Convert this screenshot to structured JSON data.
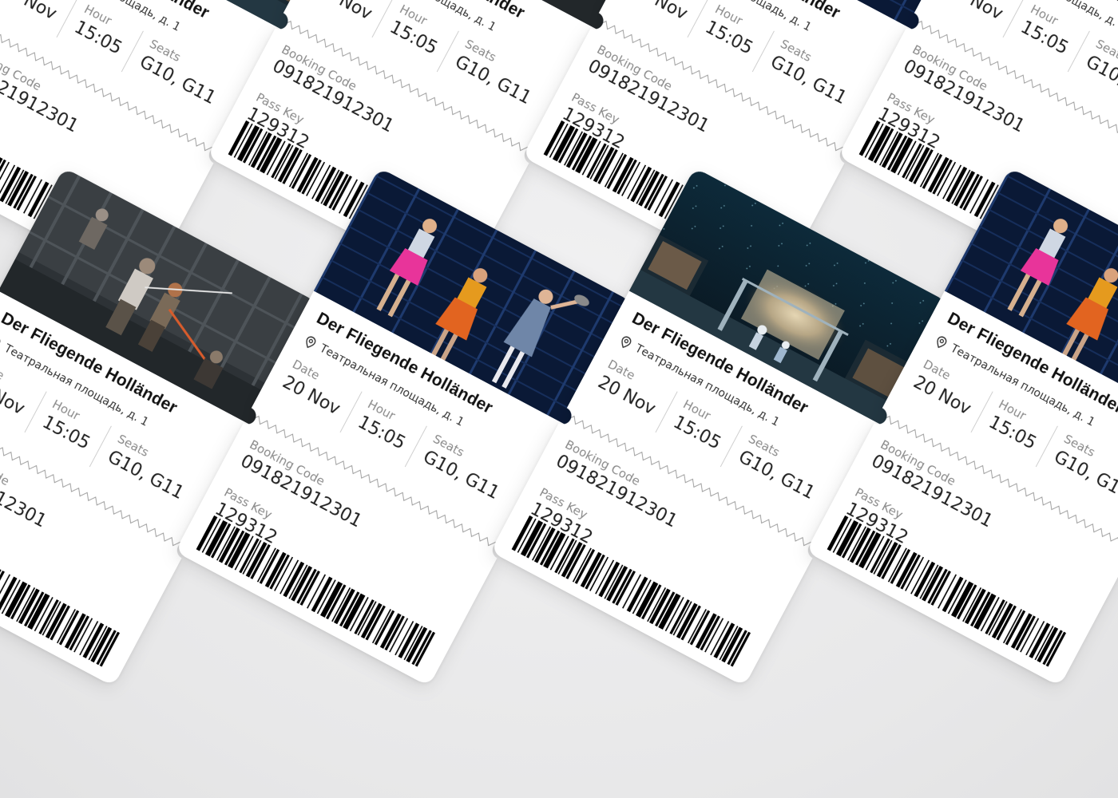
{
  "ticket": {
    "title": "Der Fliegende Holländer",
    "location": "Театральная площадь, д. 1",
    "date_label": "Date",
    "date_value": "20 Nov",
    "hour_label": "Hour",
    "hour_value": "15:05",
    "seats_label": "Seats",
    "seats_value": "G10, G11",
    "booking_label": "Booking Code",
    "booking_value": "091821912301",
    "passkey_label": "Pass Key",
    "passkey_value": "129312"
  },
  "photos": [
    {
      "scene": "stage-night-set"
    },
    {
      "scene": "swordfight-gray"
    },
    {
      "scene": "dancers-colorful"
    }
  ],
  "colors": {
    "background": "#eceded",
    "ticket": "#ffffff",
    "text": "#121212",
    "muted": "#8a8a8a"
  }
}
